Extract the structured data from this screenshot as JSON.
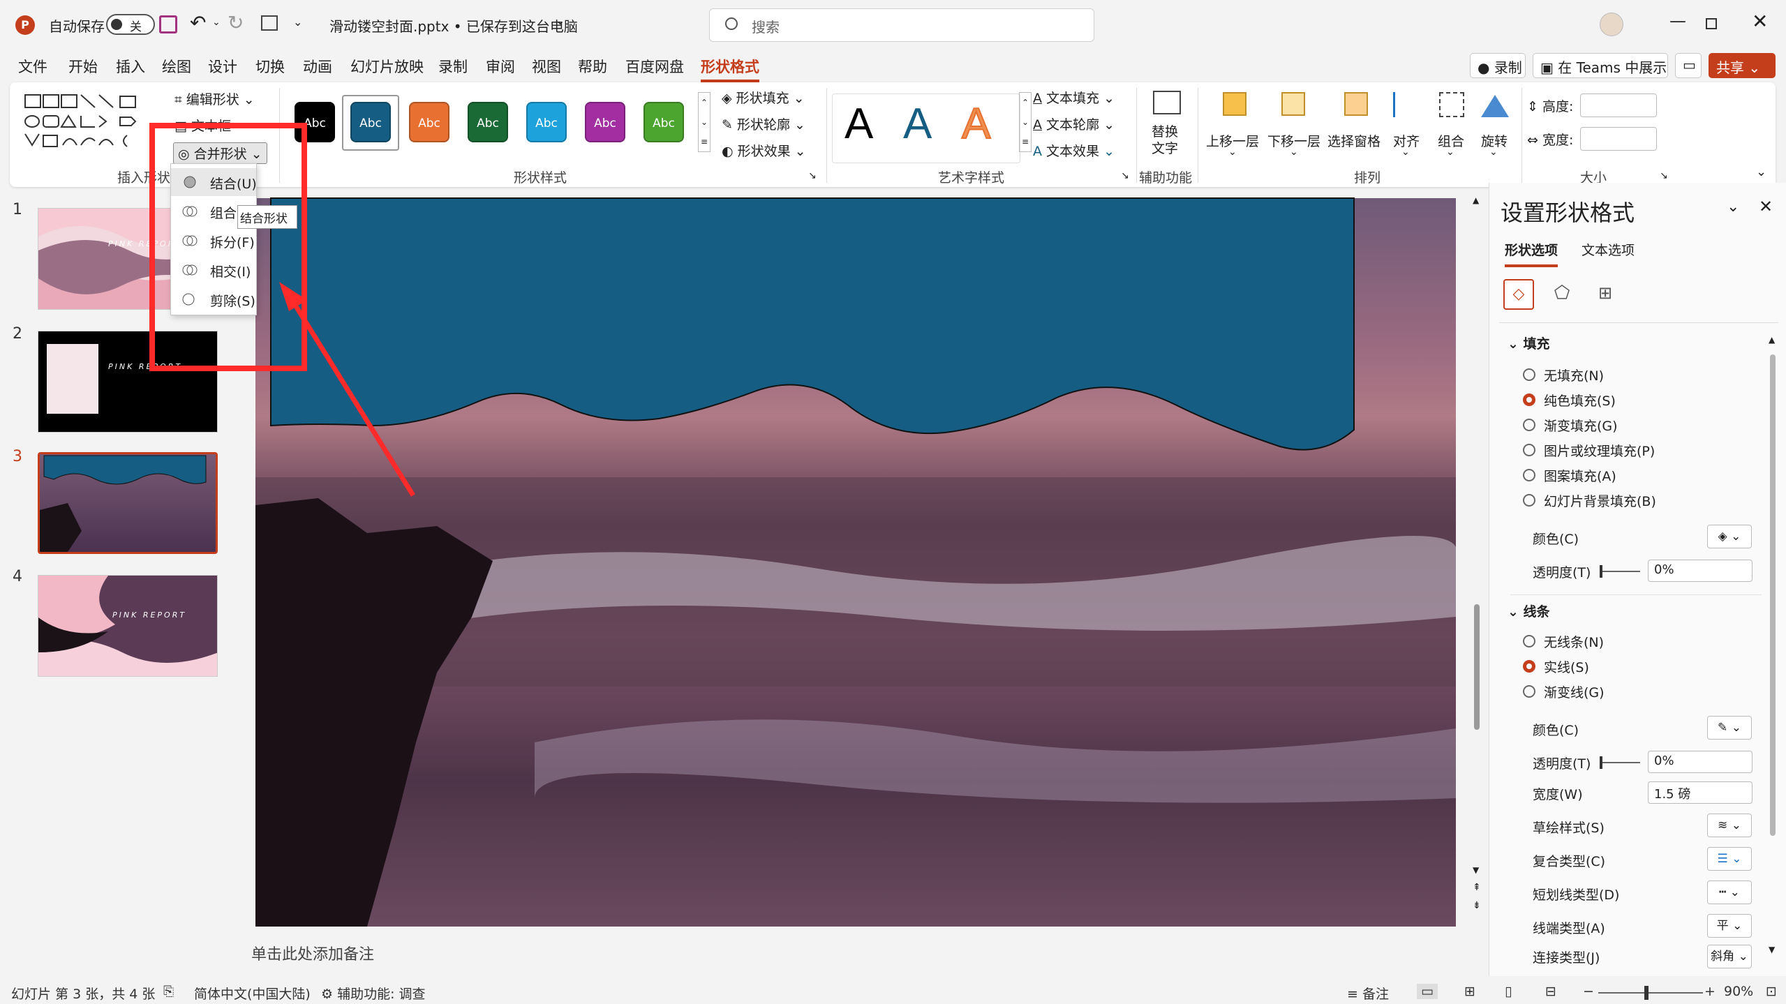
{
  "titlebar": {
    "autosave_label": "自动保存",
    "autosave_state": "关",
    "filename": "滑动镂空封面.pptx • 已保存到这台电脑",
    "search_placeholder": "搜索"
  },
  "menu": {
    "items": [
      "文件",
      "开始",
      "插入",
      "绘图",
      "设计",
      "切换",
      "动画",
      "幻灯片放映",
      "录制",
      "审阅",
      "视图",
      "帮助",
      "百度网盘",
      "形状格式"
    ],
    "active": "形状格式",
    "record_label": "录制",
    "teams_label": "在 Teams 中展示",
    "share_label": "共享"
  },
  "ribbon": {
    "insert_shapes": {
      "label": "插入形状",
      "edit_shape": "编辑形状",
      "textbox": "文本框",
      "merge_shapes": "合并形状"
    },
    "shape_styles": {
      "label": "形状样式",
      "swatch_text": "Abc",
      "swatch_colors": [
        "#000000",
        "#155d82",
        "#e87030",
        "#1a6a35",
        "#1da2dc",
        "#a22ea2",
        "#4ca52f"
      ],
      "fill": "形状填充",
      "outline": "形状轮廓",
      "effects": "形状效果"
    },
    "wordart": {
      "label": "艺术字样式",
      "letter": "A",
      "text_fill": "文本填充",
      "text_outline": "文本轮廓",
      "text_effects": "文本效果"
    },
    "accessibility": {
      "label": "辅助功能",
      "alt_text_1": "替换",
      "alt_text_2": "文字"
    },
    "arrange": {
      "label": "排列",
      "forward": "上移一层",
      "backward": "下移一层",
      "selection_pane": "选择窗格",
      "align": "对齐",
      "group": "组合",
      "rotate": "旋转"
    },
    "size": {
      "label": "大小",
      "height": "高度:",
      "width": "宽度:"
    }
  },
  "merge_menu": {
    "items": [
      "结合(U)",
      "组合(C)",
      "拆分(F)",
      "相交(I)",
      "剪除(S)"
    ],
    "tooltip": "结合形状"
  },
  "thumbnails": [
    {
      "num": "1",
      "title": "PINK REPORT"
    },
    {
      "num": "2",
      "title": "PINK REPORT"
    },
    {
      "num": "3",
      "title": ""
    },
    {
      "num": "4",
      "title": "PINK REPORT"
    }
  ],
  "notes_placeholder": "单击此处添加备注",
  "pane": {
    "title": "设置形状格式",
    "tab_shape": "形状选项",
    "tab_text": "文本选项",
    "fill_header": "填充",
    "fill_options": [
      "无填充(N)",
      "纯色填充(S)",
      "渐变填充(G)",
      "图片或纹理填充(P)",
      "图案填充(A)",
      "幻灯片背景填充(B)"
    ],
    "fill_selected": 1,
    "color_label": "颜色(C)",
    "transparency_label": "透明度(T)",
    "transparency_value": "0%",
    "line_header": "线条",
    "line_options": [
      "无线条(N)",
      "实线(S)",
      "渐变线(G)"
    ],
    "line_selected": 1,
    "line_color_label": "颜色(C)",
    "line_transparency_label": "透明度(T)",
    "line_transparency_value": "0%",
    "width_label": "宽度(W)",
    "width_value": "1.5 磅",
    "sketch_label": "草绘样式(S)",
    "compound_label": "复合类型(C)",
    "dash_label": "短划线类型(D)",
    "cap_label": "线端类型(A)",
    "cap_value": "平",
    "join_label": "连接类型(J)",
    "join_value": "斜角"
  },
  "status": {
    "slide_info": "幻灯片 第 3 张，共 4 张",
    "language": "简体中文(中国大陆)",
    "accessibility": "辅助功能: 调查",
    "notes": "备注",
    "zoom": "90%"
  },
  "colors": {
    "accent": "#c43e1c",
    "shape_fill": "#155d82",
    "annotation": "#ff2a2a"
  }
}
